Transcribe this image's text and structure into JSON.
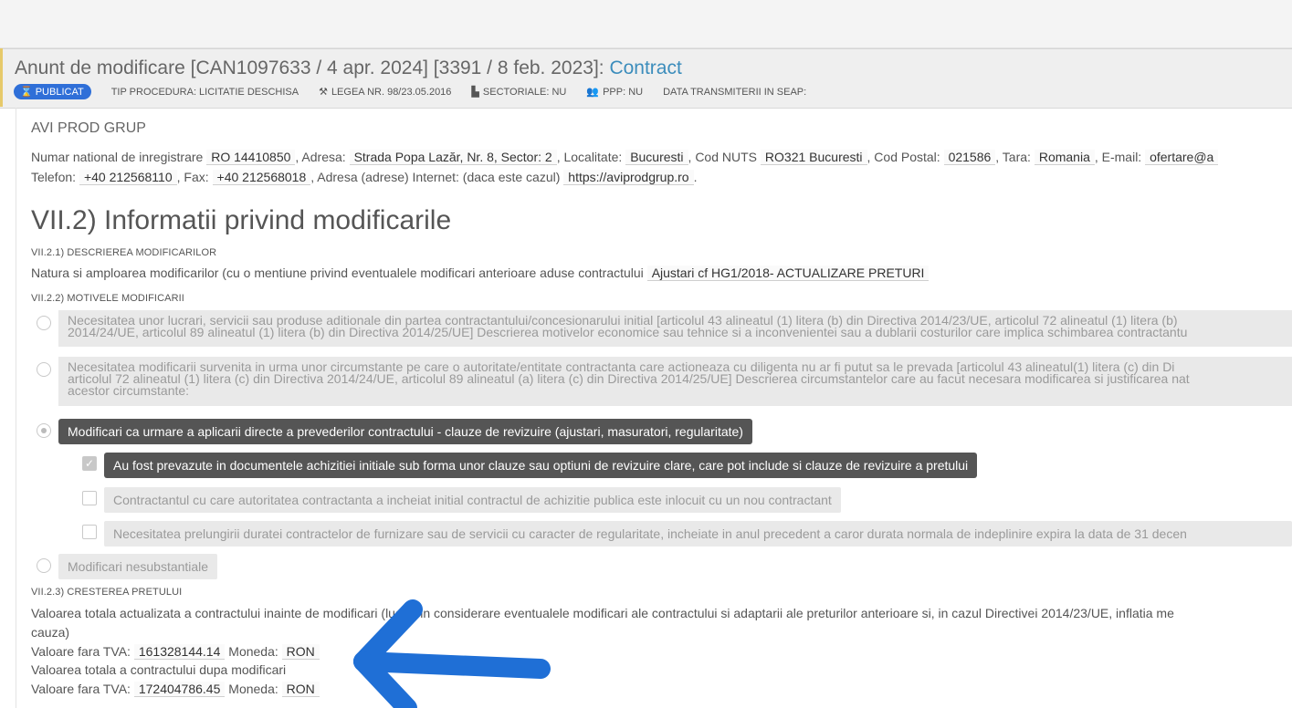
{
  "header": {
    "title_prefix": "Anunt de modificare [CAN1097633 / 4 apr. 2024] [3391 / 8 feb. 2023]: ",
    "title_link": "Contract",
    "badge": "PUBLICAT",
    "tip_procedura": "TIP PROCEDURA: LICITATIE DESCHISA",
    "legea": "LEGEA NR. 98/23.05.2016",
    "sectoriale": "SECTORIALE: NU",
    "ppp": "PPP: NU",
    "data_transmiterii": "DATA TRANSMITERII IN SEAP:"
  },
  "org": {
    "name": "AVI PROD GRUP",
    "l1": "Numar national de inregistrare",
    "reg_no": "RO 14410850",
    "l2": ", Adresa:",
    "adresa": "Strada Popa Lazăr, Nr. 8, Sector: 2",
    "l3": ", Localitate:",
    "localitate": "Bucuresti",
    "l4": ", Cod NUTS",
    "nuts": "RO321 Bucuresti",
    "l5": ", Cod Postal:",
    "cod_postal": "021586",
    "l6": ", Tara:",
    "tara": "Romania",
    "l7": ", E-mail:",
    "email": "ofertare@a",
    "l8": "Telefon:",
    "telefon": "+40 212568110",
    "l9": ", Fax:",
    "fax": "+40 212568018",
    "l10": ", Adresa (adrese) Internet: (daca este cazul)",
    "internet": "https://aviprodgrup.ro",
    "l11": "."
  },
  "section": {
    "title": "VII.2) Informatii privind modificarile",
    "s1": "VII.2.1) DESCRIEREA MODIFICARILOR",
    "natura_label": "Natura si amploarea modificarilor (cu o mentiune privind eventualele modificari anterioare aduse contractului",
    "natura_value": "Ajustari cf HG1/2018- ACTUALIZARE PRETURI",
    "s2": "VII.2.2) MOTIVELE MODIFICARII",
    "opt1_l1": "Necesitatea unor lucrari, servicii sau produse aditionale din partea contractantului/concesionarului initial [articolul 43 alineatul (1) litera (b) din Directiva 2014/23/UE, articolul 72 alineatul (1) litera (b)",
    "opt1_l2": "2014/24/UE, articolul 89 alineatul (1) litera (b) din Directiva 2014/25/UE] Descrierea motivelor economice sau tehnice si a inconvenientei sau a dublarii costurilor care implica schimbarea contractantu",
    "opt2_l1": "Necesitatea modificarii survenita in urma unor circumstante pe care o autoritate/entitate contractanta care actioneaza cu diligenta nu ar fi putut sa le prevada [articolul 43 alineatul(1) litera (c) din Di",
    "opt2_l2": "articolul 72 alineatul (1) litera (c) din Directiva 2014/24/UE, articolul 89 alineatul (a) litera (c) din Directiva 2014/25/UE] Descrierea circumstantelor care au facut necesara modificarea si justificarea nat",
    "opt2_l3": "acestor circumstante:",
    "opt3": "Modificari ca urmare a aplicarii directe a prevederilor contractului - clauze de revizuire (ajustari, masuratori, regularitate)",
    "sub1": "Au fost prevazute in documentele achizitiei initiale sub forma unor clauze sau optiuni de revizuire clare, care pot include si clauze de revizuire a pretului",
    "sub2": "Contractantul cu care autoritatea contractanta a incheiat initial contractul de achizitie publica este inlocuit cu un nou contractant",
    "sub3": "Necesitatea prelungirii duratei contractelor de furnizare sau de servicii cu caracter de regularitate, incheiate in anul precedent a caror durata normala de indeplinire expira la data de 31 decen",
    "opt4": "Modificari nesubstantiale",
    "s3": "VII.2.3) CRESTEREA PRETULUI",
    "cp_l1": "Valoarea totala actualizata a contractului inainte de modificari (luand in considerare eventualele modificari ale contractului si adaptarii ale preturilor anterioare si, in cazul Directivei 2014/23/UE, inflatia me",
    "cp_l2": "cauza)",
    "vft_label": "Valoare fara TVA:",
    "val_before": "161328144.14",
    "moneda_label": "Moneda:",
    "currency_before": "RON",
    "after_label": "Valoarea totala a contractului dupa modificari",
    "val_after": "172404786.45",
    "currency_after": "RON"
  },
  "colors": {
    "accent": "#3c8dbc",
    "badge": "#2f6fd8",
    "arrow": "#1f6fd6"
  }
}
